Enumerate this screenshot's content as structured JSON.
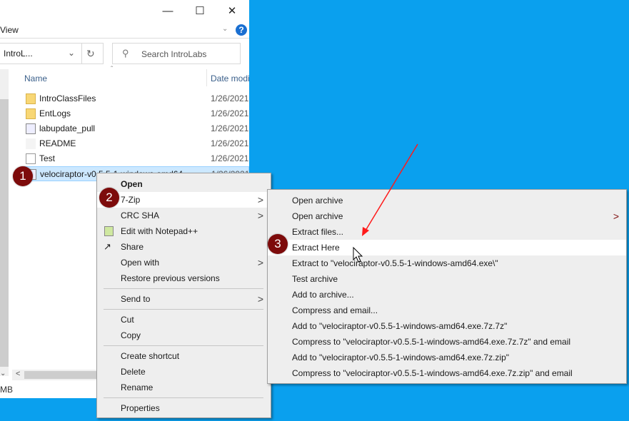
{
  "window": {
    "ribbon_view": "View",
    "address": "IntroL...",
    "search_placeholder": "Search IntroLabs",
    "status": "MB"
  },
  "columns": {
    "name": "Name",
    "date": "Date modi"
  },
  "files": [
    {
      "name": "IntroClassFiles",
      "date": "1/26/2021",
      "icon": "folder-icon"
    },
    {
      "name": "EntLogs",
      "date": "1/26/2021",
      "icon": "zip-folder-icon"
    },
    {
      "name": "labupdate_pull",
      "date": "1/26/2021",
      "icon": "executable-icon"
    },
    {
      "name": "README",
      "date": "1/26/2021",
      "icon": "text-file-icon"
    },
    {
      "name": "Test",
      "date": "1/26/2021",
      "icon": "document-icon"
    },
    {
      "name": "velociraptor-v0.5.5-1-windows-amd64",
      "date": "1/26/2021",
      "icon": "executable-icon"
    }
  ],
  "context_menu": {
    "items": [
      "Open",
      "7-Zip",
      "CRC SHA",
      "Edit with Notepad++",
      "Share",
      "Open with",
      "Restore previous versions",
      "Send to",
      "Cut",
      "Copy",
      "Create shortcut",
      "Delete",
      "Rename",
      "Properties"
    ]
  },
  "submenu": {
    "items": [
      "Open archive",
      "Open archive",
      "Extract files...",
      "Extract Here",
      "Extract to \"velociraptor-v0.5.5-1-windows-amd64.exe\\\"",
      "Test archive",
      "Add to archive...",
      "Compress and email...",
      "Add to \"velociraptor-v0.5.5-1-windows-amd64.exe.7z.7z\"",
      "Compress to \"velociraptor-v0.5.5-1-windows-amd64.exe.7z.7z\" and email",
      "Add to \"velociraptor-v0.5.5-1-windows-amd64.exe.7z.zip\"",
      "Compress to \"velociraptor-v0.5.5-1-windows-amd64.exe.7z.zip\" and email"
    ]
  },
  "badges": [
    "1",
    "2",
    "3"
  ],
  "colors": {
    "desktop": "#0aa0ee",
    "badge": "#7d0b0b",
    "arrow": "#ff0000",
    "selection": "#cce8ff"
  }
}
